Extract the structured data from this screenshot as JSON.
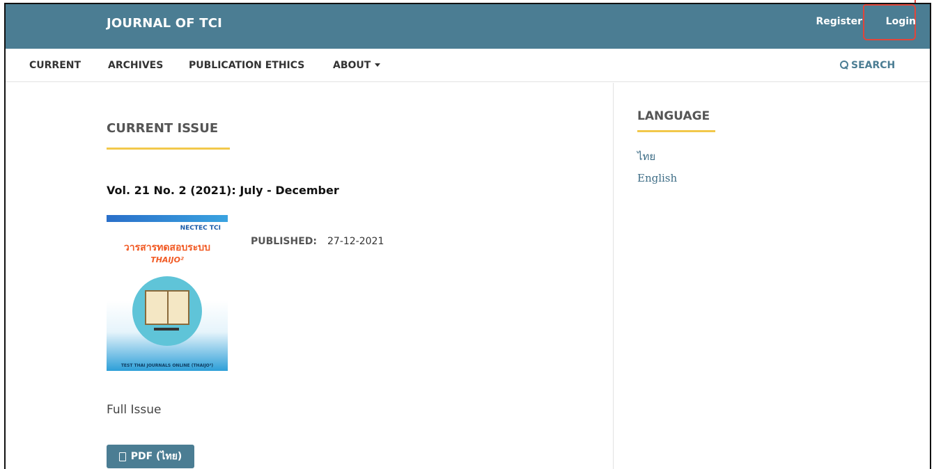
{
  "header": {
    "site_title": "JOURNAL OF TCI",
    "register_label": "Register",
    "login_label": "Login"
  },
  "nav": {
    "items": [
      {
        "label": "CURRENT"
      },
      {
        "label": "ARCHIVES"
      },
      {
        "label": "PUBLICATION ETHICS"
      },
      {
        "label": "ABOUT"
      }
    ],
    "search_label": "SEARCH"
  },
  "main": {
    "heading": "CURRENT ISSUE",
    "issue_title": "Vol. 21 No. 2 (2021): July - December",
    "cover": {
      "logos": "NECTEC TCI",
      "thai_title": "วารสารทดสอบระบบ",
      "thaijo": "THAIJO²",
      "footer": "TEST THAI JOURNALS ONLINE (THAIJO²)"
    },
    "published_label": "PUBLISHED:",
    "published_value": "27-12-2021",
    "full_issue_label": "Full Issue",
    "pdf_button_label": "PDF (ไทย)"
  },
  "sidebar": {
    "heading": "LANGUAGE",
    "languages": [
      {
        "label": "ไทย"
      },
      {
        "label": "English"
      }
    ]
  },
  "colors": {
    "header_bg": "#4b7d93",
    "accent_underline": "#f2c84b",
    "link": "#3e6d86",
    "highlight": "#e2453a"
  },
  "icons": {
    "search": "search-icon",
    "pdf": "pdf-icon",
    "caret": "chevron-down-icon"
  }
}
